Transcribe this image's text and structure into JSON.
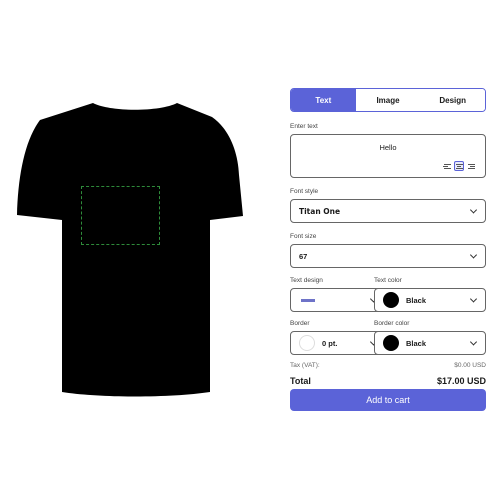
{
  "tabs": [
    {
      "label": "Text",
      "active": true
    },
    {
      "label": "Image",
      "active": false
    },
    {
      "label": "Design",
      "active": false
    }
  ],
  "enter_text": {
    "label": "Enter text",
    "value": "Hello"
  },
  "font_style": {
    "label": "Font style",
    "value": "Titan One"
  },
  "font_size": {
    "label": "Font size",
    "value": "67"
  },
  "text_design": {
    "label": "Text design"
  },
  "text_color": {
    "label": "Text color",
    "value": "Black",
    "swatch": "#000000"
  },
  "border": {
    "label": "Border",
    "value": "0 pt.",
    "swatch": "#ffffff"
  },
  "border_color": {
    "label": "Border color",
    "value": "Black",
    "swatch": "#000000"
  },
  "tax": {
    "label": "Tax (VAT):",
    "value": "$0.00 USD"
  },
  "total": {
    "label": "Total",
    "value": "$17.00 USD"
  },
  "cart_button": "Add to cart",
  "colors": {
    "accent": "#5b63d8",
    "shirt": "#000000",
    "print_area": "#2e8b3a"
  }
}
